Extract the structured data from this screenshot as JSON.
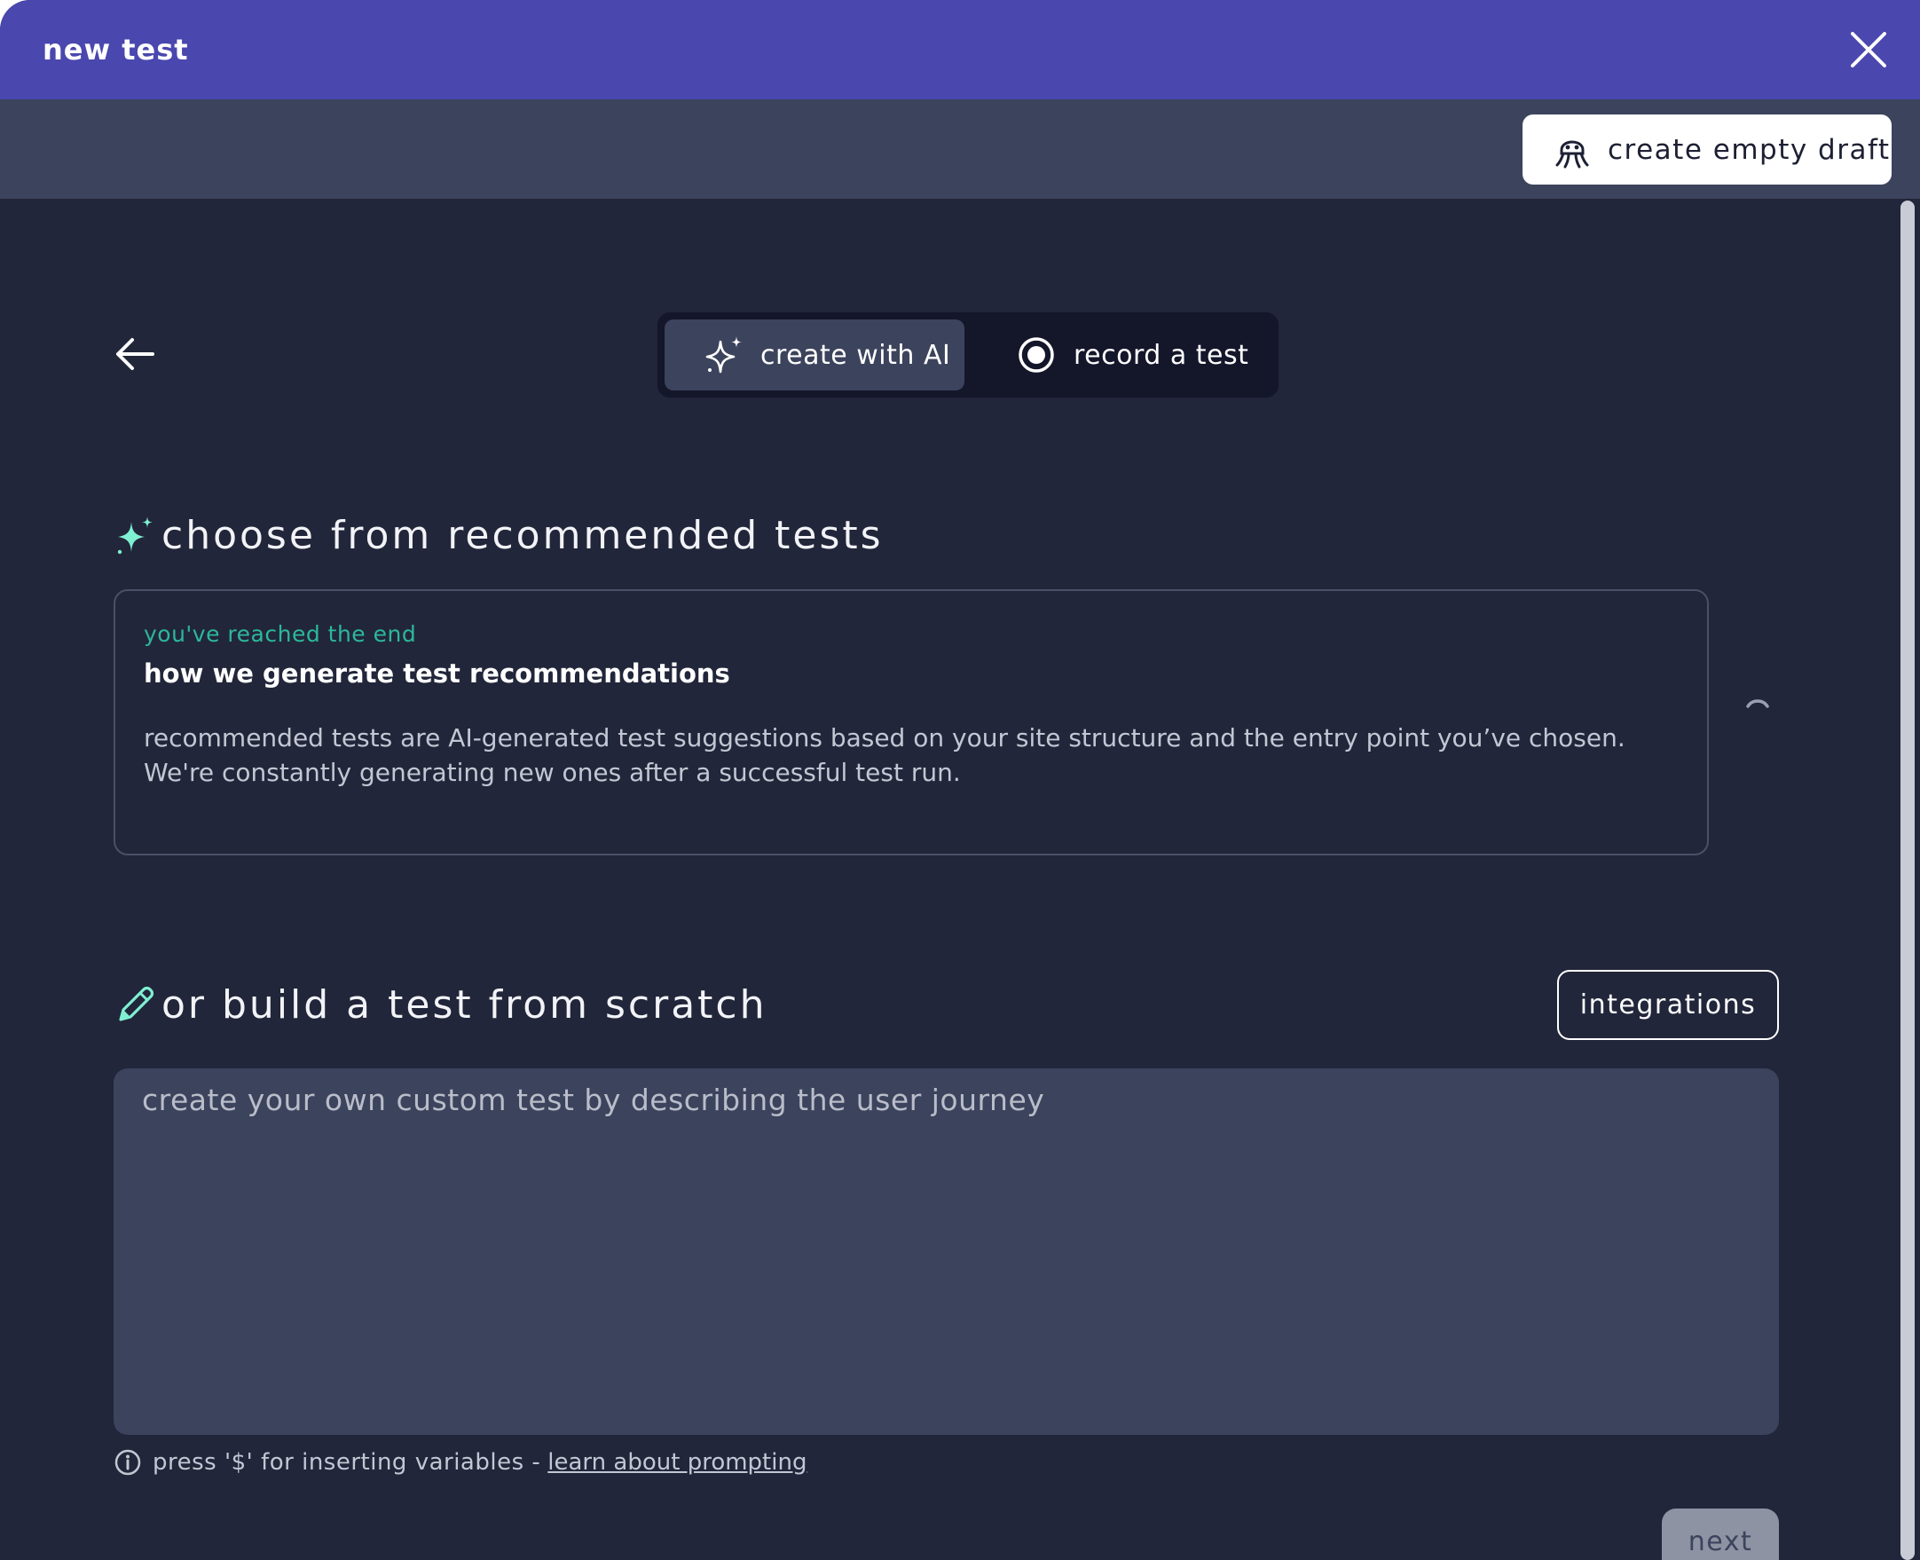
{
  "header": {
    "title": "new test",
    "close_icon": "close-icon"
  },
  "toolbar": {
    "create_draft_label": "create empty draft",
    "create_draft_icon": "octopus-icon"
  },
  "mode_toggle": {
    "options": [
      {
        "label": "create with AI",
        "icon": "sparkles-icon",
        "selected": true
      },
      {
        "label": "record a test",
        "icon": "record-icon",
        "selected": false
      }
    ]
  },
  "recommended": {
    "heading": "choose from recommended tests",
    "status": "you've reached the end",
    "card_title": "how we generate test recommendations",
    "card_body": "recommended tests are AI-generated test suggestions based on your site structure and the entry point you’ve chosen. We're constantly generating new ones after a successful test run."
  },
  "scratch": {
    "heading": "or build a test from scratch",
    "integrations_label": "integrations",
    "prompt_placeholder": "create your own custom test by describing the user journey",
    "hint_text": "press '$' for inserting variables -",
    "hint_link": "learn about prompting",
    "next_label": "next"
  },
  "colors": {
    "header_bg": "#4a47ae",
    "toolbar_bg": "#3c435c",
    "page_bg": "#22263a",
    "accent": "#2cb89a",
    "icon_accent": "#7ff0d2"
  }
}
